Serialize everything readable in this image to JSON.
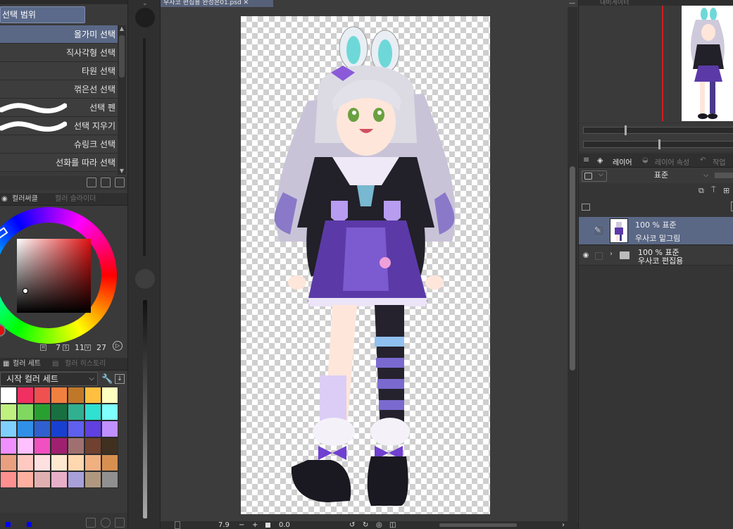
{
  "tool_panel": {
    "selection_header": "선택 범위",
    "sub_tools": [
      {
        "label": "올가미 선택",
        "active": true
      },
      {
        "label": "직사각형 선택"
      },
      {
        "label": "타원 선택"
      },
      {
        "label": "꺾은선 선택"
      },
      {
        "label": "선택 펜"
      },
      {
        "label": "선택 지우기"
      },
      {
        "label": "슈링크 선택"
      },
      {
        "label": "선화를 따라 선택"
      }
    ]
  },
  "color_panel": {
    "tab_active": "컬러써클",
    "tab_inactive": "컬러 슬라이더",
    "hsv_h": "7",
    "hsv_s": "11",
    "hsv_v": "27",
    "h_label": "H",
    "s_label": "S",
    "v_label": "V"
  },
  "color_set_panel": {
    "tab_active": "컬러 세트",
    "tab_inactive": "컬러 히스토리",
    "set_name": "시작 컬러 세트",
    "swatches": [
      "#ffffff",
      "#f03060",
      "#f05050",
      "#f08040",
      "#c07828",
      "#ffc040",
      "#ffffc0",
      "#c0f080",
      "#80d860",
      "#28a030",
      "#187040",
      "#30b090",
      "#30e0d0",
      "#80ffff",
      "#80d0ff",
      "#3090e8",
      "#3060d0",
      "#1840d0",
      "#6060f0",
      "#6040e0",
      "#c090ff",
      "#f090ff",
      "#ffc0ff",
      "#f050c0",
      "#a02070",
      "#a07070",
      "#704030",
      "#403020",
      "#e8a080",
      "#ffc8c0",
      "#ffe0e0",
      "#ffe8d0",
      "#ffd8b0",
      "#f0b080",
      "#d89050",
      "#ff9090",
      "#ffb0a0",
      "#e0b0b0",
      "#e8b0c8",
      "#a8a0d8",
      "#b09880",
      "#909090"
    ]
  },
  "document": {
    "tab_title": "우사코 편집용 완성본01.psd",
    "zoom": "7.9",
    "rotation": "0.0"
  },
  "layer_panel": {
    "tab_layer": "레이어",
    "tab_layer_props": "레이어 속성",
    "tab_history": "작업 내역",
    "blend_mode": "표준",
    "layers": [
      {
        "opacity_blend": "100 % 표준",
        "name": "우사코 밑그림",
        "selected": true
      },
      {
        "opacity_blend": "100 % 표준",
        "name": "우사코 편집용",
        "folder": true
      }
    ]
  },
  "navigator": {
    "tab_title": "내비게이터"
  },
  "colors": {
    "accent": "#5a6886",
    "main_color": "#e01010",
    "sub_color": "#0000ff"
  }
}
